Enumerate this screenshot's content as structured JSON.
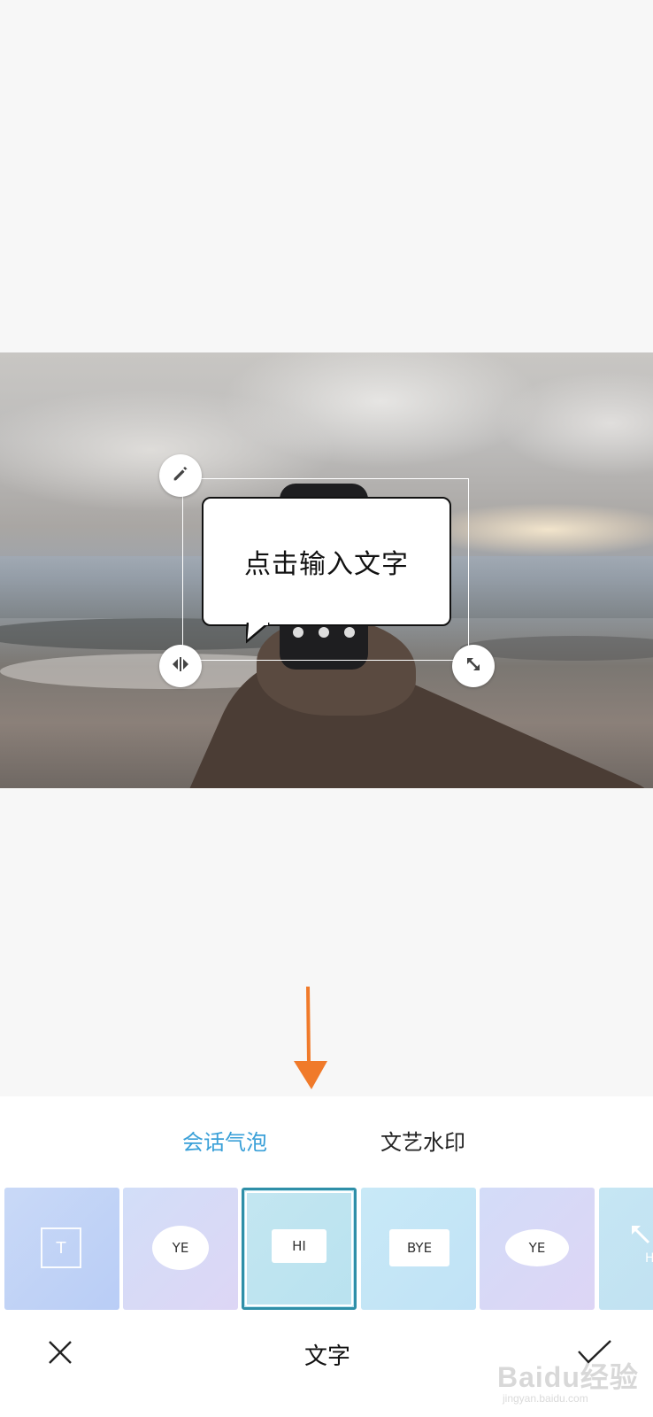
{
  "sticker": {
    "placeholder_text": "点击输入文字"
  },
  "tabs": {
    "items": [
      {
        "label": "会话气泡",
        "active": true
      },
      {
        "label": "文艺水印",
        "active": false
      }
    ],
    "active_color": "#3aa0d8"
  },
  "bubble_tiles": [
    {
      "label": "T"
    },
    {
      "label": "YE"
    },
    {
      "label": "HI",
      "selected": true
    },
    {
      "label": "BYE"
    },
    {
      "label": "YE"
    },
    {
      "label": "H"
    }
  ],
  "bottom_bar": {
    "title": "文字",
    "cancel_icon": "close-icon",
    "confirm_icon": "check-icon"
  },
  "watermark": {
    "text": "Baidu经验",
    "sub": "jingyan.baidu.com"
  },
  "colors": {
    "accent": "#3aa0d8",
    "arrow": "#f07a2a",
    "selected_border": "#2f8fa8"
  }
}
